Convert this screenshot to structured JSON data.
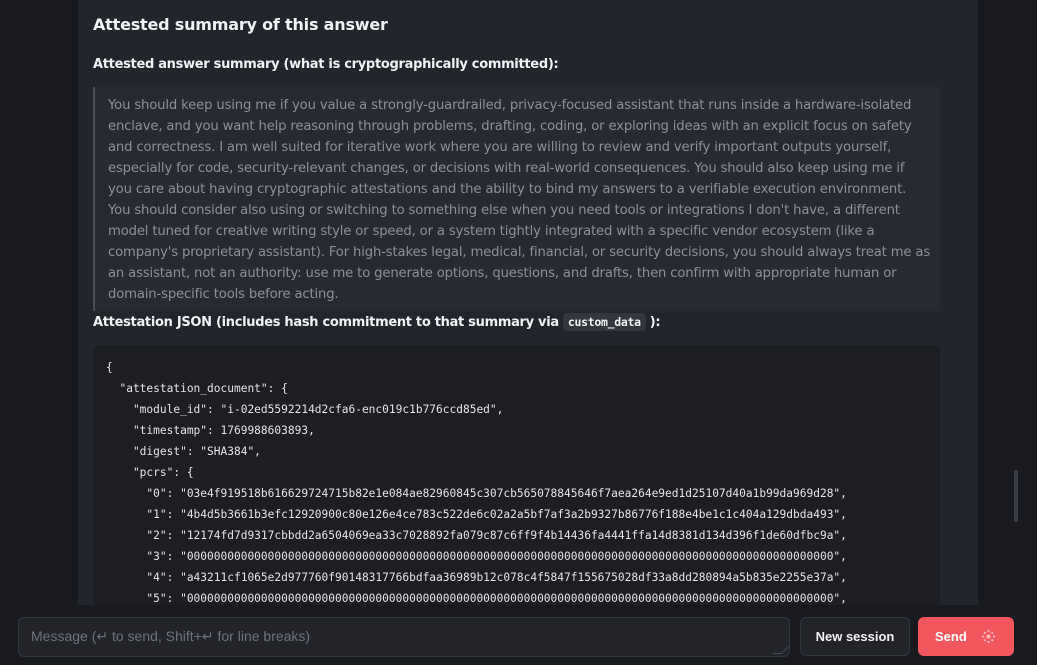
{
  "colors": {
    "background": "#181a20",
    "panel": "#23252c",
    "accent_send": "#f2575d",
    "quote_text": "#8d9098"
  },
  "answer": {
    "section_title": "Attested summary of this answer",
    "summary_label": "Attested answer summary (what is cryptographically committed):",
    "summary_text": "You should keep using me if you value a strongly-guardrailed, privacy-focused assistant that runs inside a hardware-isolated enclave, and you want help reasoning through problems, drafting, coding, or exploring ideas with an explicit focus on safety and correctness. I am well suited for iterative work where you are willing to review and verify important outputs yourself, especially for code, security-relevant changes, or decisions with real-world consequences. You should also keep using me if you care about having cryptographic attestations and the ability to bind my answers to a verifiable execution environment. You should consider also using or switching to something else when you need tools or integrations I don't have, a different model tuned for creative writing style or speed, or a system tightly integrated with a specific vendor ecosystem (like a company's proprietary assistant). For high-stakes legal, medical, financial, or security decisions, you should always treat me as an assistant, not an authority: use me to generate options, questions, and drafts, then confirm with appropriate human or domain-specific tools before acting.",
    "json_label_prefix": "Attestation JSON (includes hash commitment to that summary via",
    "json_label_code": "custom_data",
    "json_label_suffix": "):",
    "json_lines": [
      "{",
      "  \"attestation_document\": {",
      "    \"module_id\": \"i-02ed5592214d2cfa6-enc019c1b776ccd85ed\",",
      "    \"timestamp\": 1769988603893,",
      "    \"digest\": \"SHA384\",",
      "    \"pcrs\": {",
      "      \"0\": \"03e4f919518b616629724715b82e1e084ae82960845c307cb565078845646f7aea264e9ed1d25107d40a1b99da969d28\",",
      "      \"1\": \"4b4d5b3661b3efc12920900c80e126e4ce783c522de6c02a2a5bf7af3a2b9327b86776f188e4be1c1c404a129dbda493\",",
      "      \"2\": \"12174fd7d9317cbbdd2a6504069ea33c7028892fa079c87c6ff9f4b14436fa4441ffa14d8381d134d396f1de60dfbc9a\",",
      "      \"3\": \"000000000000000000000000000000000000000000000000000000000000000000000000000000000000000000000000\",",
      "      \"4\": \"a43211cf1065e2d977760f90148317766bdfaa36989b12c078c4f5847f155675028df33a8dd280894a5b835e2255e37a\",",
      "      \"5\": \"000000000000000000000000000000000000000000000000000000000000000000000000000000000000000000000000\","
    ]
  },
  "composer": {
    "placeholder": "Message (↵ to send, Shift+↵ for line breaks)",
    "new_session_label": "New session",
    "send_label": "Send",
    "send_icon": "sparkle-icon"
  }
}
